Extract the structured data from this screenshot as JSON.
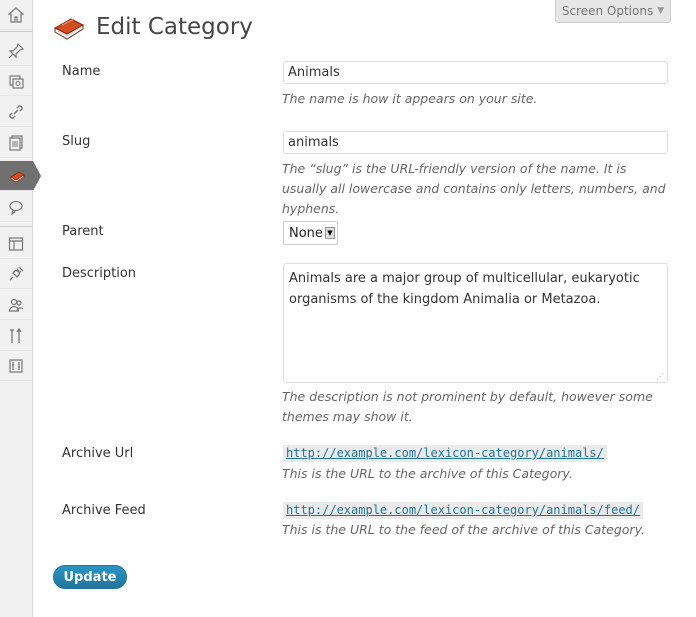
{
  "sidebar": {
    "items": [
      {
        "icon": "dashboard-icon"
      },
      {
        "icon": "posts-icon"
      },
      {
        "icon": "media-icon"
      },
      {
        "icon": "links-icon"
      },
      {
        "icon": "pages-icon"
      },
      {
        "icon": "lexicon-book-icon",
        "current": true
      },
      {
        "icon": "comments-icon"
      },
      {
        "icon": "appearance-icon"
      },
      {
        "icon": "plugins-icon"
      },
      {
        "icon": "users-icon"
      },
      {
        "icon": "tools-icon"
      },
      {
        "icon": "settings-icon"
      }
    ],
    "current_color": "#707070"
  },
  "screen_options": {
    "label": "Screen Options",
    "caret": "▼"
  },
  "header": {
    "title": "Edit Category"
  },
  "form": {
    "name": {
      "label": "Name",
      "value": "Animals",
      "help": "The name is how it appears on your site."
    },
    "slug": {
      "label": "Slug",
      "value": "animals",
      "help": "The “slug” is the URL-friendly version of the name. It is usually all lowercase and contains only letters, numbers, and hyphens."
    },
    "parent": {
      "label": "Parent",
      "value": "None"
    },
    "description": {
      "label": "Description",
      "value": "Animals are a major group of multicellular, eukaryotic organisms of the kingdom Animalia or Metazoa.",
      "help": "The description is not prominent by default, however some themes may show it."
    },
    "archive_url": {
      "label": "Archive Url",
      "link": "http://example.com/lexicon-category/animals/",
      "help": "This is the URL to the archive of this Category."
    },
    "archive_feed": {
      "label": "Archive Feed",
      "link": "http://example.com/lexicon-category/animals/feed/",
      "help": "This is the URL to the feed of the archive of this Category."
    }
  },
  "actions": {
    "update_label": "Update"
  },
  "colors": {
    "accent": "#21759b",
    "link": "#21759b",
    "book_red": "#d54e21"
  }
}
